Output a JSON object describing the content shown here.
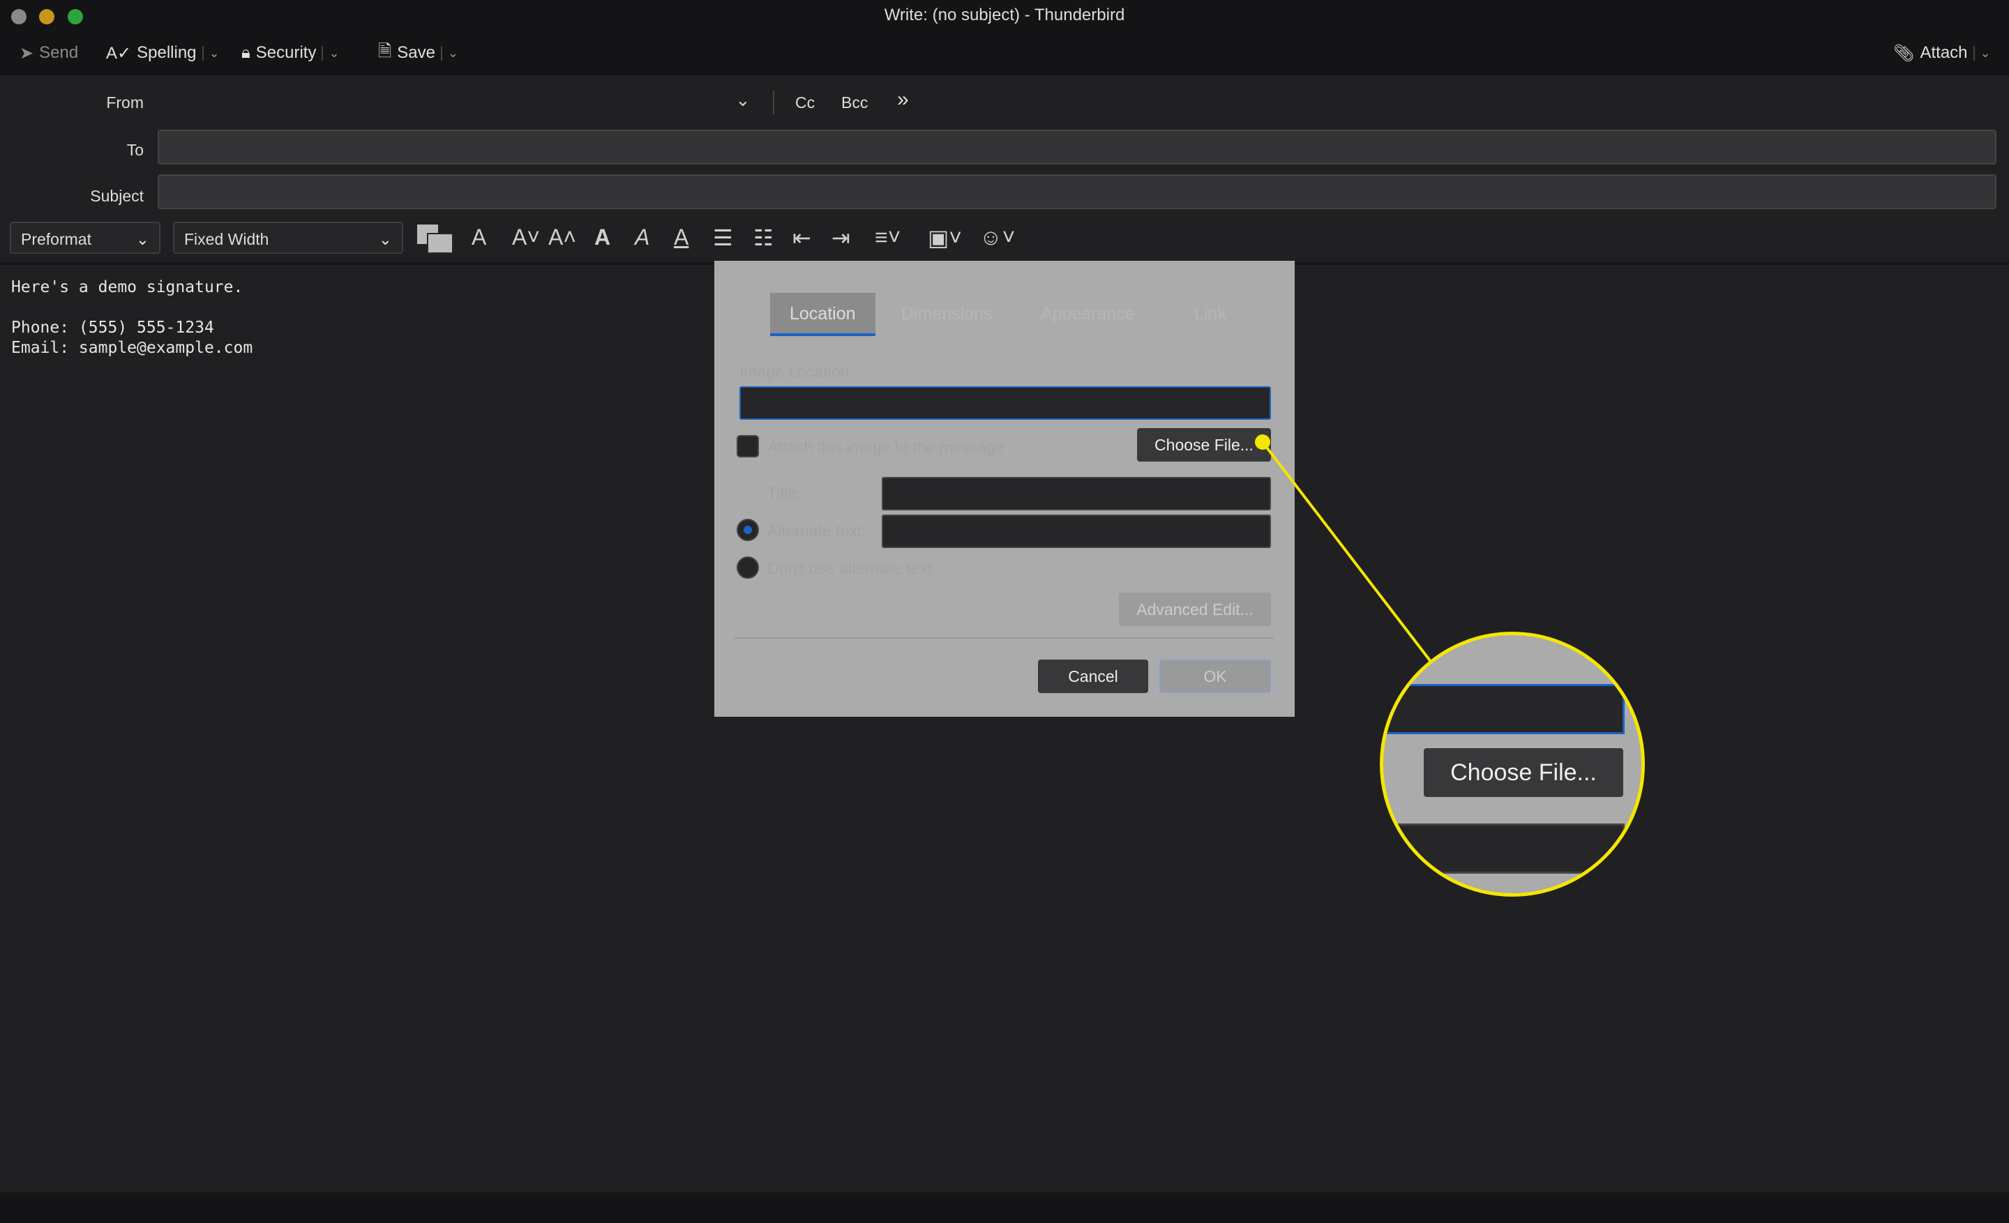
{
  "window": {
    "title": "Write: (no subject) - Thunderbird"
  },
  "toolbar": {
    "send": "Send",
    "spelling": "Spelling",
    "security": "Security",
    "save": "Save",
    "attach": "Attach"
  },
  "header": {
    "from_label": "From",
    "cc": "Cc",
    "bcc": "Bcc",
    "to_label": "To",
    "subject_label": "Subject",
    "to_value": "",
    "subject_value": ""
  },
  "format": {
    "paragraph": "Preformat",
    "font": "Fixed Width"
  },
  "body": {
    "lines": [
      "Here's a demo signature.",
      "",
      "Phone: (555) 555-1234",
      "Email: sample@example.com"
    ]
  },
  "dialog": {
    "tabs": [
      "Location",
      "Dimensions",
      "Appearance",
      "Link"
    ],
    "active_tab": "Location",
    "image_location_label": "Image Location",
    "attach_label": "Attach this image to the message",
    "choose_file": "Choose File...",
    "title_label": "Title:",
    "alt_label": "Alternate text:",
    "no_alt_label": "Don't use alternate text",
    "advanced_edit": "Advanced Edit...",
    "cancel": "Cancel",
    "ok": "OK"
  },
  "callout": {
    "label": "Choose File...",
    "color": "#f5e600"
  },
  "colors": {
    "accent": "#1a63c6",
    "highlight": "#f5e600"
  }
}
